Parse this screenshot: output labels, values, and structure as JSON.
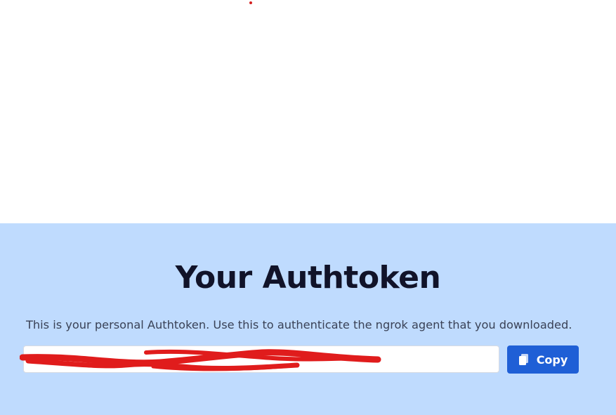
{
  "auth": {
    "title": "Your Authtoken",
    "description": "This is your personal Authtoken. Use this to authenticate the ngrok agent that you downloaded.",
    "token_value": "",
    "copy_label": "Copy",
    "copy_icon": "copy-icon"
  },
  "colors": {
    "section_background": "#bfdbfe",
    "title_text": "#111329",
    "button_background": "#1f5fd6",
    "redaction_stroke": "#e01c1c"
  }
}
